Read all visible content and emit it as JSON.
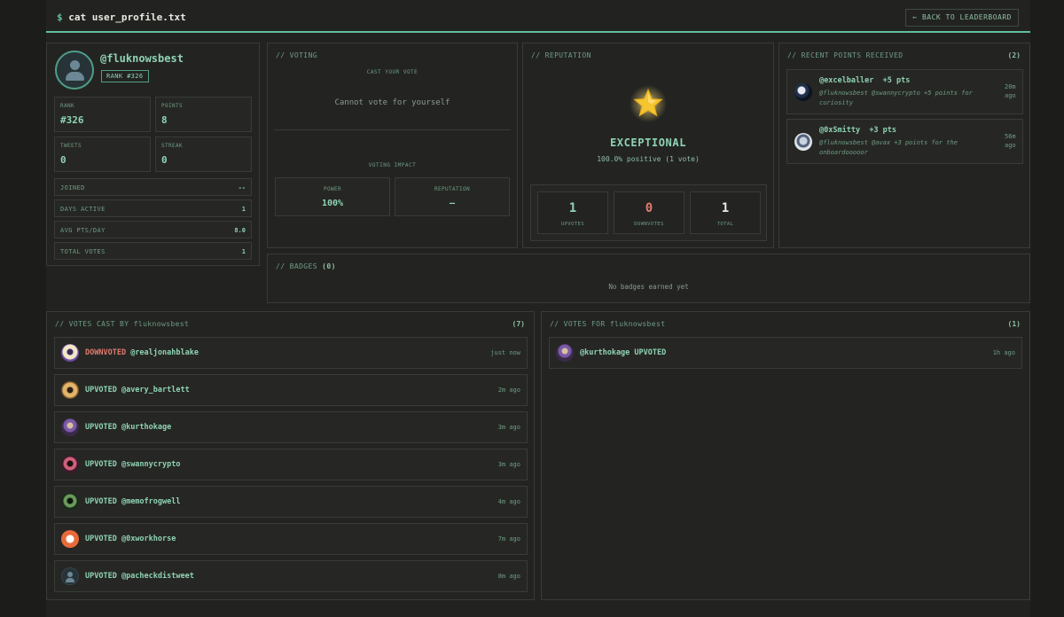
{
  "header": {
    "prompt_symbol": "$",
    "command": "cat user_profile.txt",
    "back_button": "← BACK TO LEADERBOARD"
  },
  "profile": {
    "handle": "@fluknowsbest",
    "rank_badge": "RANK #326",
    "stats": [
      {
        "label": "RANK",
        "value": "#326"
      },
      {
        "label": "POINTS",
        "value": "8"
      },
      {
        "label": "TWEETS",
        "value": "0"
      },
      {
        "label": "STREAK",
        "value": "0"
      }
    ],
    "info": [
      {
        "label": "JOINED",
        "value": "--"
      },
      {
        "label": "DAYS ACTIVE",
        "value": "1"
      },
      {
        "label": "AVG PTS/DAY",
        "value": "8.0"
      },
      {
        "label": "TOTAL VOTES",
        "value": "1"
      }
    ]
  },
  "voting": {
    "title": "// VOTING",
    "cast_caption": "CAST YOUR VOTE",
    "cannot_vote": "Cannot vote for yourself",
    "impact_caption": "VOTING IMPACT",
    "impact": [
      {
        "label": "POWER",
        "value": "100%"
      },
      {
        "label": "REPUTATION",
        "value": "—"
      }
    ]
  },
  "reputation": {
    "title": "// REPUTATION",
    "icon": "star-icon",
    "level": "EXCEPTIONAL",
    "summary": "100.0% positive (1 vote)",
    "stats": [
      {
        "value": "1",
        "label": "UPVOTES",
        "color": "#8fd3b4"
      },
      {
        "value": "0",
        "label": "DOWNVOTES",
        "color": "#e07a6e"
      },
      {
        "value": "1",
        "label": "TOTAL",
        "color": "#e8e8e0"
      }
    ]
  },
  "recent_points": {
    "title": "// RECENT POINTS RECEIVED",
    "count": "(2)",
    "items": [
      {
        "user": "@excelballer",
        "points": "+5 pts",
        "message": "@fluknowsbest @swannycrypto +5 points for curiosity",
        "time": "20m ago"
      },
      {
        "user": "@0xSmitty",
        "points": "+3 pts",
        "message": "@fluknowsbest @avax +3 points for the onboardooooor",
        "time": "56m ago"
      }
    ]
  },
  "badges": {
    "title": "// BADGES",
    "count": "(0)",
    "empty": "No badges earned yet"
  },
  "votes_cast": {
    "title": "// VOTES CAST BY fluknowsbest",
    "count": "(7)",
    "items": [
      {
        "direction": "DOWNVOTED",
        "target": "@realjonahblake",
        "time": "just now"
      },
      {
        "direction": "UPVOTED",
        "target": "@avery_bartlett",
        "time": "2m ago"
      },
      {
        "direction": "UPVOTED",
        "target": "@kurthokage",
        "time": "3m ago"
      },
      {
        "direction": "UPVOTED",
        "target": "@swannycrypto",
        "time": "3m ago"
      },
      {
        "direction": "UPVOTED",
        "target": "@memofrogwell",
        "time": "4m ago"
      },
      {
        "direction": "UPVOTED",
        "target": "@0xworkhorse",
        "time": "7m ago"
      },
      {
        "direction": "UPVOTED",
        "target": "@pacheckdistweet",
        "time": "8m ago"
      }
    ]
  },
  "votes_for": {
    "title": "// VOTES FOR fluknowsbest",
    "count": "(1)",
    "items": [
      {
        "voter": "@kurthokage",
        "direction": "UPVOTED",
        "time": "1h ago"
      }
    ]
  }
}
